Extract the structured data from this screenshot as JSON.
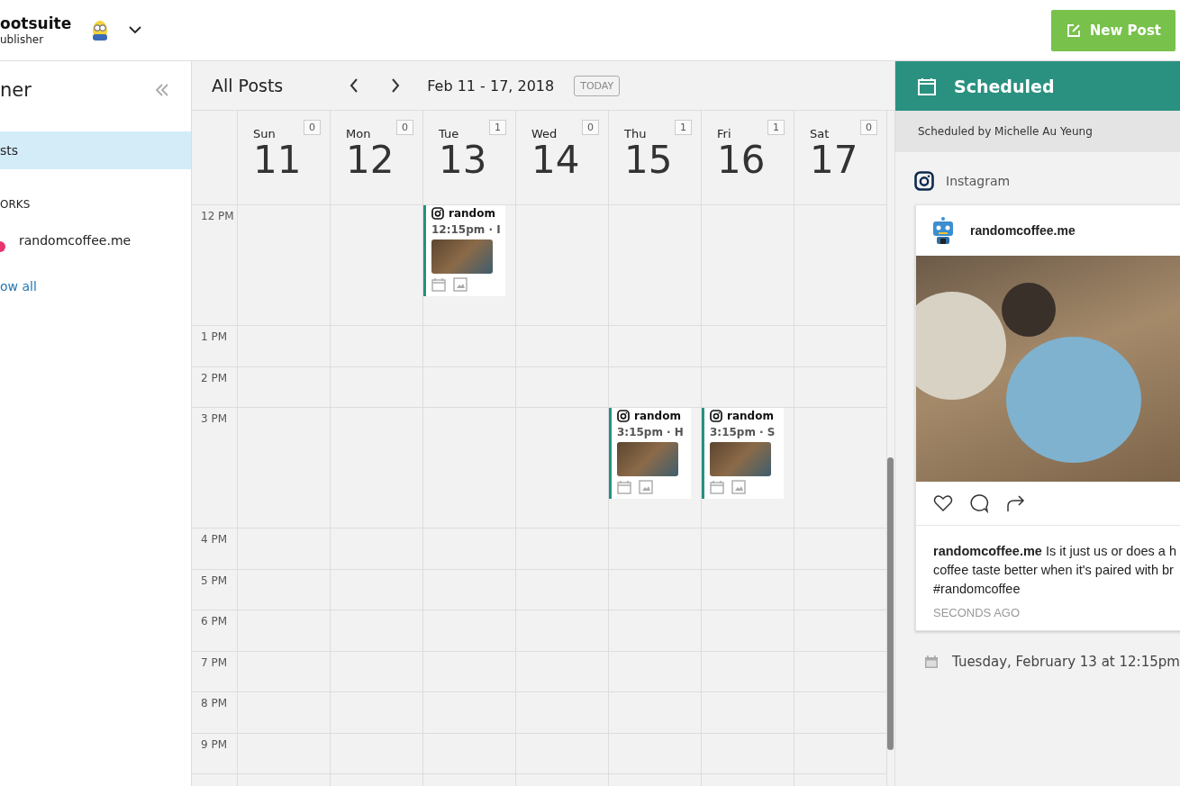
{
  "app": {
    "name": "ootsuite",
    "subtitle": "ublisher"
  },
  "new_post_button": {
    "label": "New Post"
  },
  "sidebar": {
    "title": "ner",
    "nav_items": [
      {
        "label": "sts",
        "selected": true
      }
    ],
    "networks_heading": "ORKS",
    "networks": [
      {
        "name": "randomcoffee.me",
        "color": "#e8336d"
      }
    ],
    "show_all_link": "ow all"
  },
  "calendar": {
    "title": "All Posts",
    "date_range": "Feb 11 - 17, 2018",
    "today_button": "TODAY",
    "days": [
      {
        "name": "Sun",
        "date": "11",
        "count": "0"
      },
      {
        "name": "Mon",
        "date": "12",
        "count": "0"
      },
      {
        "name": "Tue",
        "date": "13",
        "count": "1"
      },
      {
        "name": "Wed",
        "date": "14",
        "count": "0"
      },
      {
        "name": "Thu",
        "date": "15",
        "count": "1"
      },
      {
        "name": "Fri",
        "date": "16",
        "count": "1"
      },
      {
        "name": "Sat",
        "date": "17",
        "count": "0"
      }
    ],
    "time_slots": [
      {
        "label": "12 PM",
        "cells": [
          null,
          null,
          {
            "account": "random",
            "time_text": "12:15pm · I"
          },
          null,
          null,
          null,
          null
        ]
      },
      {
        "label": "1 PM"
      },
      {
        "label": "2 PM"
      },
      {
        "label": "3 PM",
        "cells": [
          null,
          null,
          null,
          null,
          {
            "account": "random",
            "time_text": "3:15pm · H"
          },
          {
            "account": "random",
            "time_text": "3:15pm · S"
          },
          null
        ]
      },
      {
        "label": "4 PM"
      },
      {
        "label": "5 PM"
      },
      {
        "label": "6 PM"
      },
      {
        "label": "7 PM"
      },
      {
        "label": "8 PM"
      },
      {
        "label": "9 PM"
      }
    ]
  },
  "panel": {
    "title": "Scheduled",
    "scheduled_by": "Scheduled by Michelle Au Yeung",
    "network": "Instagram",
    "preview": {
      "account": "randomcoffee.me",
      "caption_lines": [
        "**randomcoffee.me** Is it just us or does a h",
        "coffee taste better when it's paired with br",
        "#randomcoffee"
      ],
      "timestamp": "SECONDS AGO"
    },
    "schedule_time": "Tuesday, February 13 at 12:15pm"
  }
}
